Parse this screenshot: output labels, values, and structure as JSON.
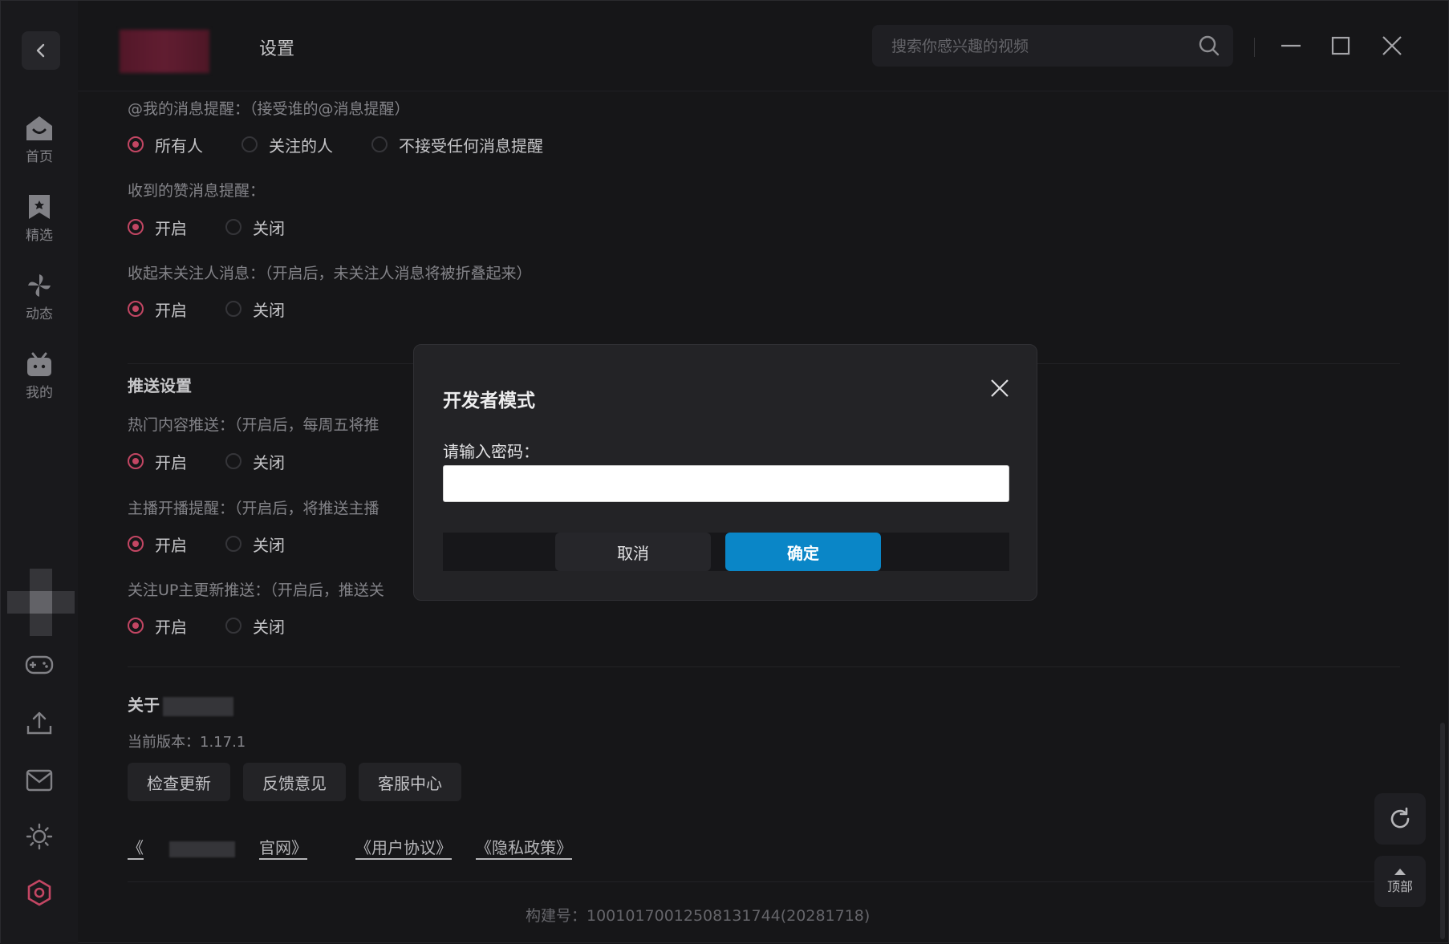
{
  "app": {
    "title": "设置"
  },
  "search": {
    "placeholder": "搜索你感兴趣的视频"
  },
  "nav": {
    "home": "首页",
    "featured": "精选",
    "dynamic": "动态",
    "mine": "我的"
  },
  "settings": {
    "at_label": "@我的消息提醒：（接受谁的@消息提醒）",
    "at_options": [
      "所有人",
      "关注的人",
      "不接受任何消息提醒"
    ],
    "like_label": "收到的赞消息提醒：",
    "fold_label": "收起未关注人消息：（开启后，未关注人消息将被折叠起来）",
    "on": "开启",
    "off": "关闭",
    "push_title": "推送设置",
    "hot_label": "热门内容推送：（开启后，每周五将推",
    "live_label": "主播开播提醒：（开启后，将推送主播",
    "up_label": "关注UP主更新推送：（开启后，推送关"
  },
  "about": {
    "title": "关于",
    "version_label": "当前版本：",
    "version": "1.17.1",
    "buttons": [
      "检查更新",
      "反馈意见",
      "客服中心"
    ],
    "link_site_prefix": "《",
    "link_site_suffix": "官网》",
    "link_agreement": "《用户协议》",
    "link_privacy": "《隐私政策》",
    "build": "构建号：10010170012508131744(20281718)"
  },
  "float": {
    "top": "顶部"
  },
  "modal": {
    "title": "开发者模式",
    "prompt": "请输入密码：",
    "cancel": "取消",
    "ok": "确定",
    "input_value": ""
  },
  "colors": {
    "accent": "#d44d6c",
    "primary_button": "#0a86c7"
  }
}
